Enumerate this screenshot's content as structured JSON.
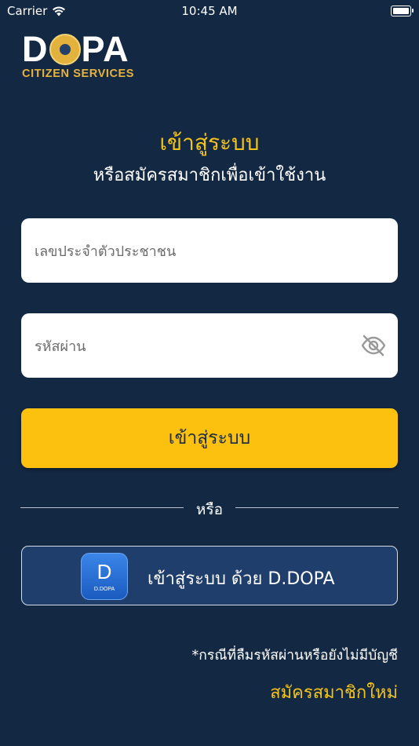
{
  "status_bar": {
    "carrier": "Carrier",
    "time": "10:45 AM",
    "wifi_icon": "wifi-icon",
    "battery_icon": "battery-icon"
  },
  "logo": {
    "brand": "DOPA",
    "brand_left": "D",
    "brand_right": "PA",
    "subtitle": "CITIZEN SERVICES"
  },
  "heading": {
    "title": "เข้าสู่ระบบ",
    "subtitle": "หรือสมัครสมาชิกเพื่อเข้าใช้งาน"
  },
  "form": {
    "id_field": {
      "placeholder": "เลขประจำตัวประชาชน",
      "value": ""
    },
    "password_field": {
      "placeholder": "รหัสผ่าน",
      "value": "",
      "toggle_icon": "eye-off-icon"
    },
    "login_label": "เข้าสู่ระบบ"
  },
  "divider": {
    "label": "หรือ"
  },
  "ddopa": {
    "label": "เข้าสู่ระบบ ด้วย D.DOPA",
    "icon_letter": "D",
    "icon_caption": "D.DOPA"
  },
  "footer": {
    "note": "*กรณีที่ลืมรหัสผ่านหรือยังไม่มีบัญชี",
    "register_label": "สมัครสมาชิกใหม่"
  },
  "colors": {
    "background": "#132843",
    "accent": "#f5c419",
    "button": "#fbc10e",
    "ddopa_button": "#1f3e6c"
  }
}
